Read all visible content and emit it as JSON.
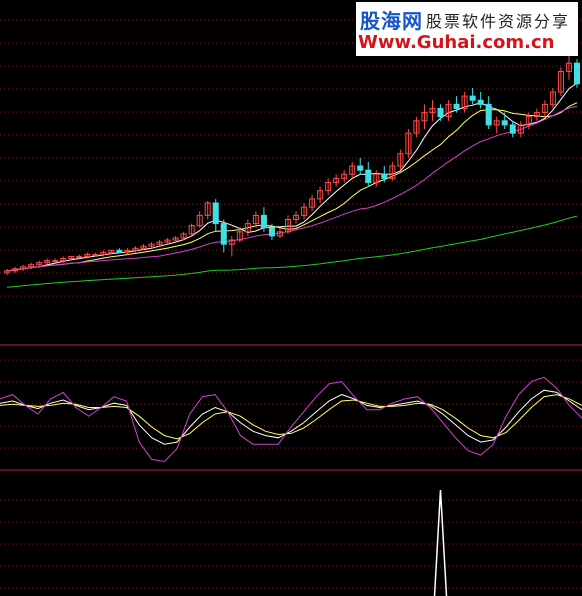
{
  "watermark": {
    "site_name": "股海网",
    "tagline": "股票软件资源分享",
    "url": "Www.Guhai.com.cn"
  },
  "colors": {
    "background": "#000000",
    "grid": "#8b1a1a",
    "panel_border": "#c0203a",
    "candle_up": "#ff4a4a",
    "candle_down": "#40e0e6",
    "ma_short": "#ffffff",
    "ma_mid": "#ffff66",
    "ma_long": "#cc44cc",
    "ma_very_long": "#22cc22",
    "kdj_k": "#ffffff",
    "kdj_d": "#ffff66",
    "kdj_j": "#cc44cc",
    "signal": "#ffffff"
  },
  "chart_data": [
    {
      "type": "candlestick",
      "panel": "price",
      "candles": [
        [
          10,
          12,
          9,
          11
        ],
        [
          11,
          13,
          10,
          12
        ],
        [
          12,
          14,
          11,
          13
        ],
        [
          13,
          15,
          12,
          14
        ],
        [
          14,
          16,
          13,
          15
        ],
        [
          15,
          17,
          14,
          16
        ],
        [
          16,
          17,
          15,
          16
        ],
        [
          16,
          18,
          15,
          17
        ],
        [
          17,
          18,
          16,
          18
        ],
        [
          18,
          19,
          17,
          18
        ],
        [
          18,
          20,
          17,
          19
        ],
        [
          19,
          20,
          18,
          19
        ],
        [
          19,
          21,
          18,
          20
        ],
        [
          20,
          21,
          19,
          21
        ],
        [
          21,
          22,
          20,
          20
        ],
        [
          20,
          22,
          19,
          21
        ],
        [
          21,
          23,
          20,
          22
        ],
        [
          22,
          24,
          21,
          23
        ],
        [
          23,
          25,
          22,
          24
        ],
        [
          24,
          26,
          23,
          25
        ],
        [
          25,
          27,
          24,
          26
        ],
        [
          26,
          28,
          25,
          27
        ],
        [
          27,
          30,
          26,
          29
        ],
        [
          29,
          34,
          28,
          33
        ],
        [
          33,
          40,
          32,
          38
        ],
        [
          38,
          45,
          36,
          44
        ],
        [
          44,
          46,
          30,
          34
        ],
        [
          34,
          36,
          20,
          24
        ],
        [
          24,
          28,
          18,
          26
        ],
        [
          26,
          32,
          25,
          30
        ],
        [
          30,
          36,
          28,
          34
        ],
        [
          34,
          40,
          32,
          38
        ],
        [
          38,
          42,
          30,
          32
        ],
        [
          32,
          34,
          26,
          28
        ],
        [
          28,
          32,
          27,
          30
        ],
        [
          30,
          38,
          29,
          36
        ],
        [
          36,
          40,
          34,
          38
        ],
        [
          38,
          44,
          36,
          42
        ],
        [
          42,
          48,
          40,
          46
        ],
        [
          46,
          52,
          44,
          50
        ],
        [
          50,
          56,
          48,
          54
        ],
        [
          54,
          58,
          52,
          56
        ],
        [
          56,
          60,
          54,
          58
        ],
        [
          58,
          64,
          56,
          62
        ],
        [
          62,
          66,
          58,
          60
        ],
        [
          60,
          64,
          52,
          54
        ],
        [
          54,
          60,
          52,
          58
        ],
        [
          58,
          62,
          54,
          56
        ],
        [
          56,
          64,
          55,
          62
        ],
        [
          62,
          70,
          60,
          68
        ],
        [
          68,
          80,
          66,
          78
        ],
        [
          78,
          86,
          76,
          84
        ],
        [
          84,
          92,
          80,
          88
        ],
        [
          88,
          94,
          84,
          90
        ],
        [
          90,
          92,
          84,
          86
        ],
        [
          86,
          94,
          84,
          92
        ],
        [
          92,
          96,
          88,
          90
        ],
        [
          90,
          98,
          88,
          96
        ],
        [
          96,
          100,
          92,
          94
        ],
        [
          94,
          98,
          90,
          92
        ],
        [
          92,
          96,
          80,
          82
        ],
        [
          82,
          86,
          78,
          84
        ],
        [
          84,
          88,
          80,
          82
        ],
        [
          82,
          84,
          76,
          78
        ],
        [
          78,
          84,
          76,
          82
        ],
        [
          82,
          88,
          80,
          86
        ],
        [
          86,
          90,
          84,
          88
        ],
        [
          88,
          94,
          86,
          92
        ],
        [
          92,
          100,
          90,
          98
        ],
        [
          98,
          110,
          96,
          108
        ],
        [
          108,
          116,
          104,
          112
        ],
        [
          112,
          114,
          100,
          102
        ]
      ],
      "series": [
        {
          "name": "",
          "color_key": "ma_short",
          "period": 5
        },
        {
          "name": "",
          "color_key": "ma_mid",
          "period": 10
        },
        {
          "name": "",
          "color_key": "ma_long",
          "period": 20
        },
        {
          "name": "",
          "color_key": "ma_very_long",
          "period": 60
        }
      ],
      "grid": true
    },
    {
      "type": "line",
      "panel": "oscillator",
      "series": [
        {
          "name": "",
          "color_key": "kdj_k",
          "values": [
            60,
            62,
            58,
            55,
            60,
            63,
            58,
            54,
            56,
            60,
            58,
            40,
            28,
            22,
            24,
            38,
            50,
            56,
            52,
            42,
            34,
            30,
            28,
            34,
            42,
            52,
            62,
            68,
            64,
            58,
            56,
            58,
            60,
            62,
            58,
            50,
            40,
            30,
            24,
            26,
            38,
            52,
            64,
            72,
            70,
            62,
            54
          ]
        },
        {
          "name": "",
          "color_key": "kdj_d",
          "values": [
            58,
            59,
            58,
            57,
            58,
            60,
            59,
            56,
            56,
            57,
            56,
            48,
            38,
            30,
            27,
            32,
            42,
            50,
            52,
            48,
            40,
            34,
            31,
            32,
            37,
            45,
            54,
            62,
            63,
            60,
            57,
            57,
            58,
            60,
            59,
            54,
            46,
            37,
            30,
            28,
            33,
            44,
            56,
            66,
            68,
            64,
            58
          ]
        },
        {
          "name": "",
          "color_key": "kdj_j",
          "values": [
            64,
            68,
            58,
            50,
            64,
            70,
            56,
            48,
            56,
            66,
            62,
            24,
            8,
            6,
            18,
            50,
            66,
            68,
            52,
            30,
            22,
            22,
            22,
            38,
            52,
            66,
            78,
            80,
            66,
            54,
            54,
            60,
            64,
            66,
            56,
            42,
            28,
            16,
            12,
            22,
            48,
            68,
            80,
            84,
            74,
            58,
            46
          ]
        }
      ],
      "grid": true
    },
    {
      "type": "line",
      "panel": "signal",
      "series": [
        {
          "name": "",
          "color_key": "signal",
          "values": [
            0,
            0,
            0,
            0,
            0,
            0,
            0,
            0,
            0,
            0,
            0,
            0,
            0,
            0,
            0,
            0,
            0,
            0,
            0,
            0,
            0,
            0,
            0,
            0,
            0,
            0,
            0,
            0,
            0,
            0,
            0,
            0,
            0,
            0,
            0,
            0,
            0,
            0,
            0,
            0,
            0,
            0,
            0,
            0,
            0,
            0,
            0,
            0,
            0,
            0,
            0,
            0,
            0,
            0,
            1,
            0,
            0,
            0,
            0,
            0,
            0,
            0,
            0,
            0,
            0,
            0,
            0,
            0,
            0,
            0,
            0,
            0
          ]
        }
      ]
    }
  ]
}
